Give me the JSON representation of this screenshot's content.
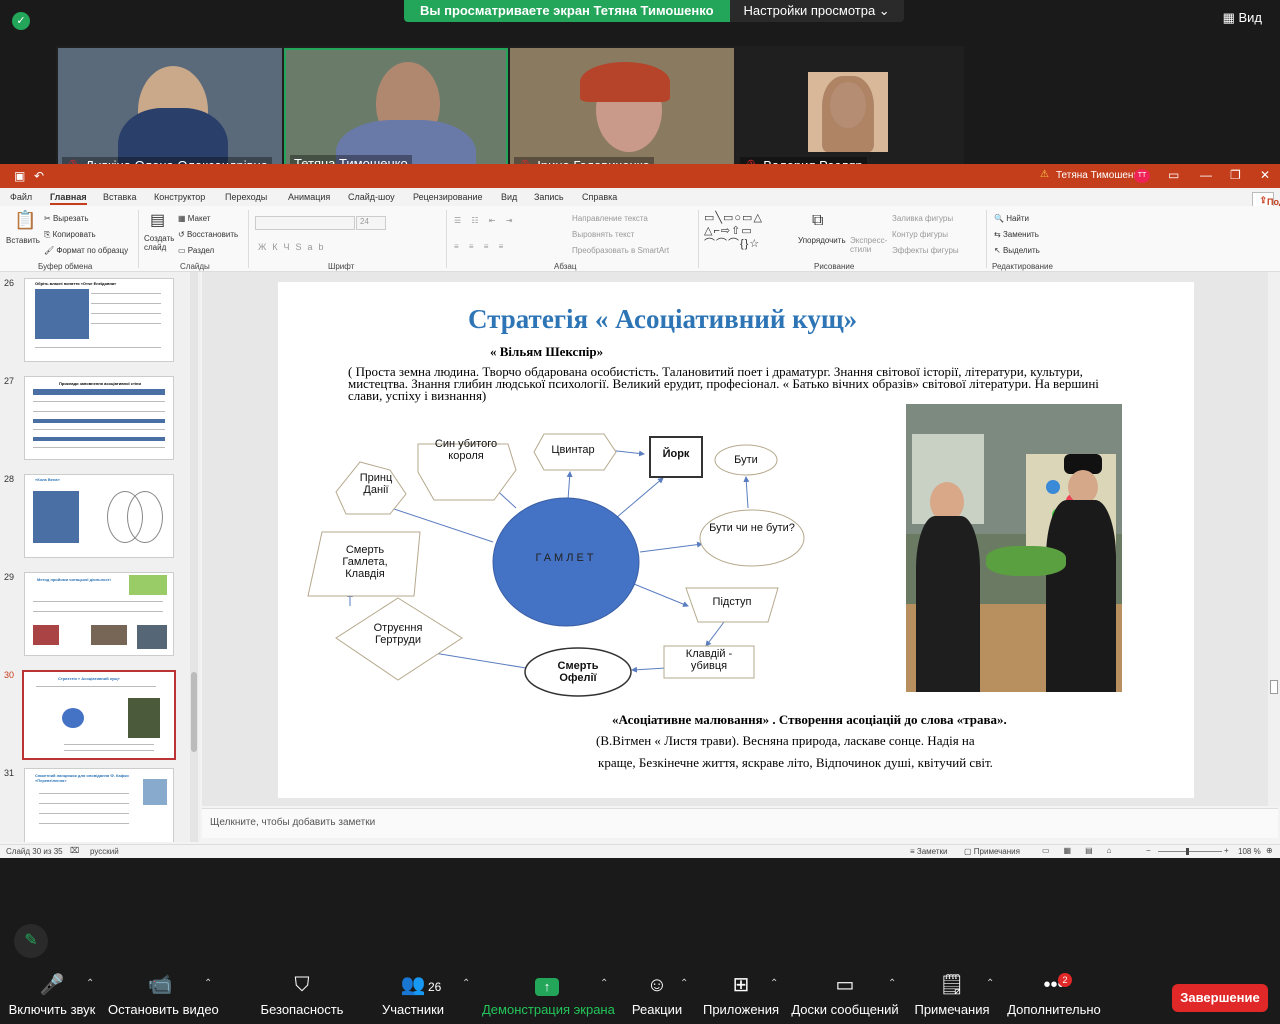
{
  "zoom": {
    "share_banner": "Вы просматриваете экран Тетяна Тимошенко",
    "view_settings": "Настройки просмотра",
    "view_label": "Вид",
    "participants": [
      {
        "name": "Дудкіна Олена Олександрівна",
        "muted": true
      },
      {
        "name": "Тетяна Тимошенко",
        "muted": false
      },
      {
        "name": "Ірина Годовиченко",
        "muted": true
      },
      {
        "name": "Валерия Ресляр",
        "muted": true
      }
    ],
    "toolbar": {
      "audio": "Включить звук",
      "video": "Остановить видео",
      "security": "Безопасность",
      "participants": "Участники",
      "participants_count": "26",
      "share": "Демонстрация экрана",
      "reactions": "Реакции",
      "apps": "Приложения",
      "whiteboards": "Доски сообщений",
      "notes": "Примечания",
      "more": "Дополнительно",
      "more_badge": "2",
      "end": "Завершение"
    }
  },
  "ppt": {
    "user": "Тетяна Тимошенко",
    "user_initials": "TT",
    "menu": [
      "Файл",
      "Главная",
      "Вставка",
      "Конструктор",
      "Переходы",
      "Анимация",
      "Слайд-шоу",
      "Рецензирование",
      "Вид",
      "Запись",
      "Справка"
    ],
    "share_button": "Поделиться",
    "ribbon": {
      "paste": "Вставить",
      "cut": "Вырезать",
      "copy": "Копировать",
      "format_painter": "Формат по образцу",
      "clipboard_group": "Буфер обмена",
      "new_slide": "Создать слайд",
      "layout": "Макет",
      "reset": "Восстановить",
      "section": "Раздел",
      "slides_group": "Слайды",
      "font_size": "24",
      "font_group": "Шрифт",
      "text_direction": "Направление текста",
      "align_text": "Выровнять текст",
      "smartart": "Преобразовать в SmartArt",
      "paragraph_group": "Абзац",
      "arrange": "Упорядочить",
      "quick_styles": "Экспресс-стили",
      "shape_fill": "Заливка фигуры",
      "shape_outline": "Контур фигуры",
      "shape_effects": "Эффекты фигуры",
      "drawing_group": "Рисование",
      "find": "Найти",
      "replace": "Заменить",
      "select": "Выделить",
      "editing_group": "Редактирование"
    },
    "thumbnails": [
      {
        "num": "26",
        "title": "Обрiть власнi поняття «Отче Енеїдовна»"
      },
      {
        "num": "27",
        "title": "Приклади заповнення асоціативної стіни"
      },
      {
        "num": "28",
        "title": "«Кола Вена»"
      },
      {
        "num": "29",
        "title": "Метод прийоми читацької діяльності"
      },
      {
        "num": "30",
        "title": "Стратегія « Асоціативний кущ»"
      },
      {
        "num": "31",
        "title": "Сюжетний ланцюжок для оповідання Ф. Кафки «Перевтілення»"
      }
    ],
    "notes_placeholder": "Щелкните, чтобы добавить заметки",
    "status": {
      "slide_info": "Слайд 30 из 35",
      "language": "русский",
      "notes": "Заметки",
      "comments": "Примечания",
      "zoom": "108 %"
    }
  },
  "slide": {
    "title": "Стратегія « Асоціативний кущ»",
    "subtitle": "« Вільям Шекспір»",
    "text": "( Проста земна людина. Творчо обдарована особистість. Талановитий поет і драматург. Знання світової історії, літератури, культури, мистецтва. Знання глибин людської психології. Великий ерудит, професіонал. « Батько вічних образів» світової літератури. На вершині слави, успіху і визнання)",
    "center": "ГАМЛЕТ",
    "nodes": {
      "prince": "Принц Данії",
      "son": "Син убитого короля",
      "graveyard": "Цвинтар",
      "yorick": "Йорк",
      "to_be": "Бути",
      "to_be_or_not": "Бути чи не бути?",
      "treachery": "Підступ",
      "claudius": "Клавдій - убивця",
      "ophelia": "Смерть Офелії",
      "gertrude": "Отруєння Гертруди",
      "death": "Смерть Гамлета, Клавдія"
    },
    "caption1": "«Асоціативне малювання» . Створення асоціацій до слова «трава».",
    "caption2": "(В.Вітмен « Листя трави). Весняна природа, ласкаве сонце. Надія на",
    "caption3": "краще, Безкінечне життя, яскраве літо, Відпочинок душі, квітучий світ."
  }
}
